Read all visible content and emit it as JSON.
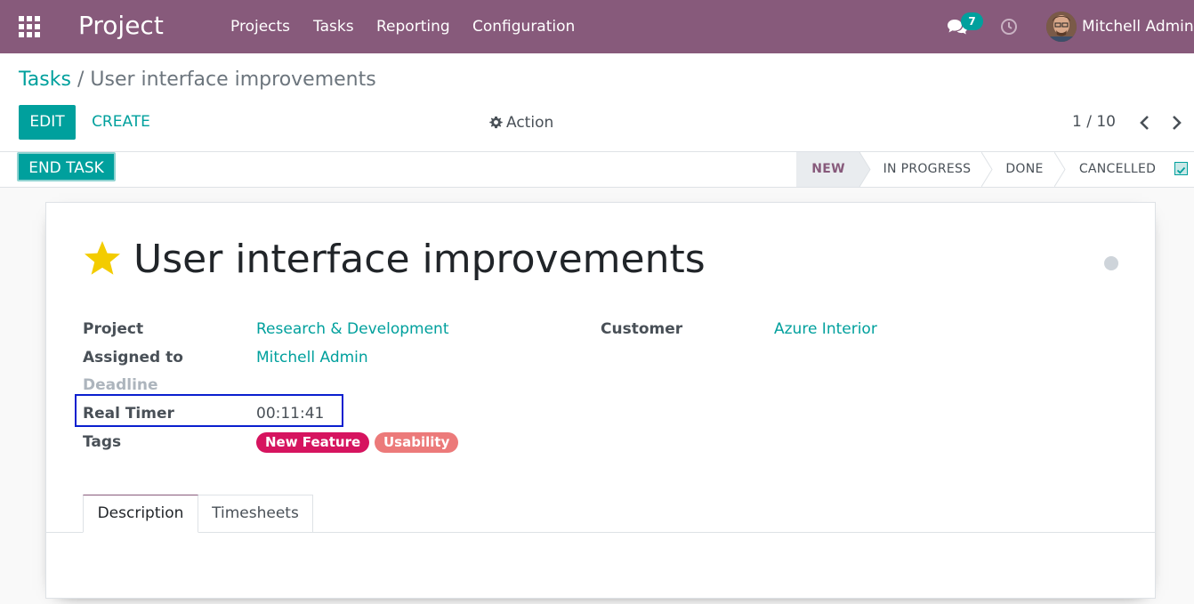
{
  "navbar": {
    "brand": "Project",
    "menu": [
      "Projects",
      "Tasks",
      "Reporting",
      "Configuration"
    ],
    "messages_count": "7",
    "user_name": "Mitchell Admin",
    "bg_color": "#875a7b"
  },
  "breadcrumb": {
    "parent": "Tasks",
    "separator": "/",
    "current": "User interface improvements"
  },
  "toolbar": {
    "edit_label": "EDIT",
    "create_label": "CREATE",
    "action_label": "Action",
    "pager": "1 / 10"
  },
  "statusbar": {
    "end_task_label": "END TASK",
    "stages": [
      "NEW",
      "IN PROGRESS",
      "DONE",
      "CANCELLED"
    ],
    "active_stage": "NEW"
  },
  "task": {
    "title": "User interface improvements",
    "starred": true,
    "fields": {
      "project_label": "Project",
      "project_value": "Research & Development",
      "assigned_label": "Assigned to",
      "assigned_value": "Mitchell Admin",
      "deadline_label": "Deadline",
      "timer_label": "Real Timer",
      "timer_value": "00:11:41",
      "tags_label": "Tags",
      "customer_label": "Customer",
      "customer_value": "Azure Interior"
    },
    "tags": [
      {
        "label": "New Feature",
        "color": "#d6145f"
      },
      {
        "label": "Usability",
        "color": "#ec7a7a"
      }
    ]
  },
  "tabs": [
    "Description",
    "Timesheets"
  ],
  "colors": {
    "accent": "#00a09d",
    "brand": "#875a7b"
  }
}
